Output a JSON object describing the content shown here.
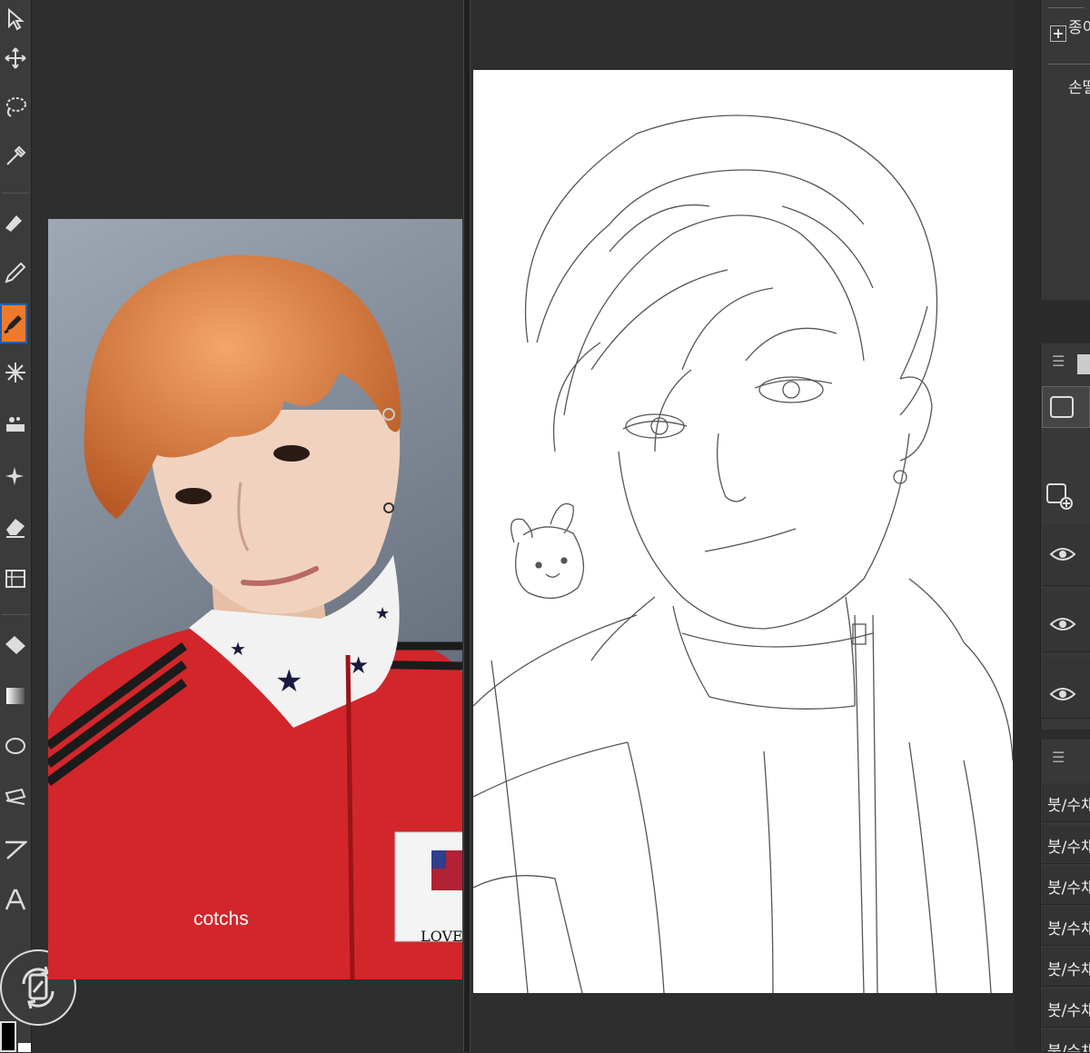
{
  "panel_top": {
    "paper_label": "종이",
    "hand_label": "손떨"
  },
  "brush_list": {
    "items": [
      {
        "label": "붓/수채"
      },
      {
        "label": "붓/수채"
      },
      {
        "label": "붓/수채"
      },
      {
        "label": "붓/수채"
      },
      {
        "label": "붓/수채"
      },
      {
        "label": "붓/수채"
      },
      {
        "label": "붓/수채"
      }
    ]
  },
  "photo": {
    "jacket_brand": "cotchs",
    "patch_text": "LOVE A"
  },
  "colors": {
    "accent": "#f07a2c",
    "ui_dark": "#2e2e2e",
    "panel": "#383838",
    "jacket_red": "#d2262a",
    "hair": "#e0894a"
  }
}
